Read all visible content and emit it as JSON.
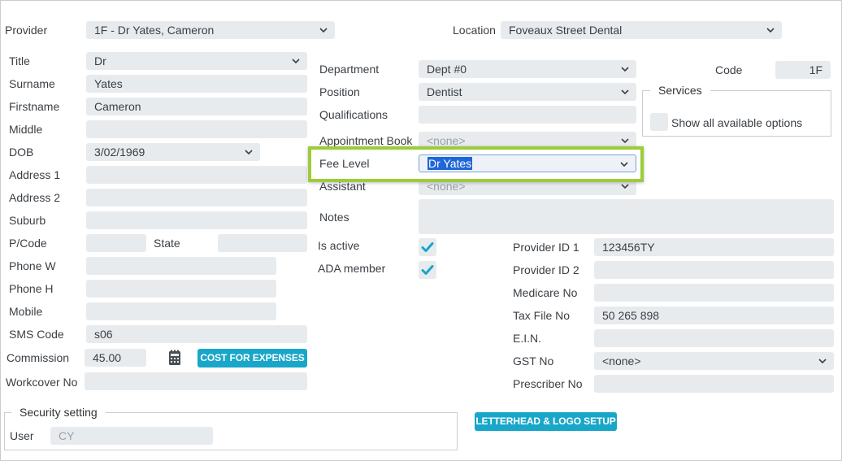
{
  "header": {
    "provider_label": "Provider",
    "provider_value": "1F - Dr Yates, Cameron",
    "location_label": "Location",
    "location_value": "Foveaux Street Dental"
  },
  "left": {
    "title_label": "Title",
    "title_value": "Dr",
    "surname_label": "Surname",
    "surname_value": "Yates",
    "firstname_label": "Firstname",
    "firstname_value": "Cameron",
    "middle_label": "Middle",
    "middle_value": "",
    "dob_label": "DOB",
    "dob_value": "3/02/1969",
    "address1_label": "Address 1",
    "address1_value": "",
    "address2_label": "Address 2",
    "address2_value": "",
    "suburb_label": "Suburb",
    "suburb_value": "",
    "pcode_label": "P/Code",
    "pcode_value": "",
    "state_label": "State",
    "state_value": "",
    "phonew_label": "Phone W",
    "phonew_value": "",
    "phoneh_label": "Phone H",
    "phoneh_value": "",
    "mobile_label": "Mobile",
    "mobile_value": "",
    "sms_label": "SMS Code",
    "sms_value": "s06",
    "commission_label": "Commission",
    "commission_value": "45.00",
    "cost_button": "COST FOR EXPENSES",
    "workcover_label": "Workcover No",
    "workcover_value": ""
  },
  "middle": {
    "department_label": "Department",
    "department_value": "Dept #0",
    "position_label": "Position",
    "position_value": "Dentist",
    "qualifications_label": "Qualifications",
    "qualifications_value": "",
    "appointment_label": "Appointment Book",
    "appointment_value": "<none>",
    "fee_label": "Fee Level",
    "fee_value": "Dr Yates",
    "assistant_label": "Assistant",
    "assistant_value": "<none>",
    "notes_label": "Notes",
    "notes_value": "",
    "is_active_label": "Is active",
    "is_active_checked": true,
    "ada_label": "ADA member",
    "ada_checked": true,
    "letterhead_button": "LETTERHEAD & LOGO SETUP"
  },
  "right": {
    "code_label": "Code",
    "code_value": "1F",
    "services_legend": "Services",
    "show_all_label": "Show all available options",
    "provider_id1_label": "Provider ID 1",
    "provider_id1_value": "123456TY",
    "provider_id2_label": "Provider ID 2",
    "provider_id2_value": "",
    "medicare_label": "Medicare No",
    "medicare_value": "",
    "taxfile_label": "Tax File No",
    "taxfile_value": "50 265 898",
    "ein_label": "E.I.N.",
    "ein_value": "",
    "gst_label": "GST No",
    "gst_value": "<none>",
    "prescriber_label": "Prescriber No",
    "prescriber_value": ""
  },
  "security": {
    "legend": "Security setting",
    "user_label": "User",
    "user_value": "CY"
  },
  "colors": {
    "accent": "#18a6c9",
    "highlight": "#9ccc3a",
    "field_bg": "#e8ebee",
    "selection": "#1f66d6"
  },
  "icons": {
    "dropdown": "chevron-down-icon",
    "checkbox": "checkmark-icon",
    "calculator": "calculator-icon"
  }
}
